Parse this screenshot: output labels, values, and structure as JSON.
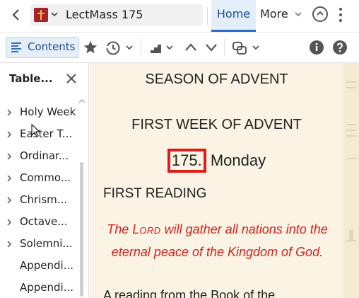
{
  "topbar": {
    "book_title": "LectMass 175",
    "tab_home": "Home",
    "tab_more": "More"
  },
  "toolbar": {
    "contents_label": "Contents"
  },
  "sidebar": {
    "title": "Table...",
    "items": [
      {
        "label": "Holy Week",
        "expandable": true
      },
      {
        "label": "Easter T...",
        "expandable": true
      },
      {
        "label": "Ordinar...",
        "expandable": true
      },
      {
        "label": "Commo...",
        "expandable": true
      },
      {
        "label": "Chrism...",
        "expandable": true
      },
      {
        "label": "Octave...",
        "expandable": true
      },
      {
        "label": "Solemni...",
        "expandable": true
      },
      {
        "label": "Appendi...",
        "expandable": false
      },
      {
        "label": "Appendi...",
        "expandable": false
      }
    ]
  },
  "reader": {
    "season": "SEASON OF ADVENT",
    "week": "FIRST WEEK OF ADVENT",
    "day_number": "175.",
    "day_name": "Monday",
    "reading_heading": "FIRST READING",
    "antiphon_pre": "The ",
    "antiphon_lord_initial": "L",
    "antiphon_lord_rest": "ORD",
    "antiphon_post": " will gather all nations into the eternal peace of the Kingdom of God.",
    "cutoff_line": "A reading from the Book of the"
  },
  "colors": {
    "accent": "#2f6ec6",
    "highlight_box": "#e01b1b",
    "rubric_red": "#d4221f",
    "reader_background": "#fbf3e3",
    "book_icon": "#a3252a"
  },
  "icons": {
    "back": "chevron-left-icon",
    "book": "book-cross-icon",
    "favorite": "star-icon",
    "history": "history-icon",
    "visual_filter": "stairs-icon",
    "prev": "chevron-up-icon",
    "next": "chevron-down-icon",
    "link": "link-icon",
    "info": "info-icon",
    "help": "help-icon",
    "close": "close-icon",
    "circle_up": "circle-up-icon",
    "menu": "kebab-menu-icon"
  }
}
